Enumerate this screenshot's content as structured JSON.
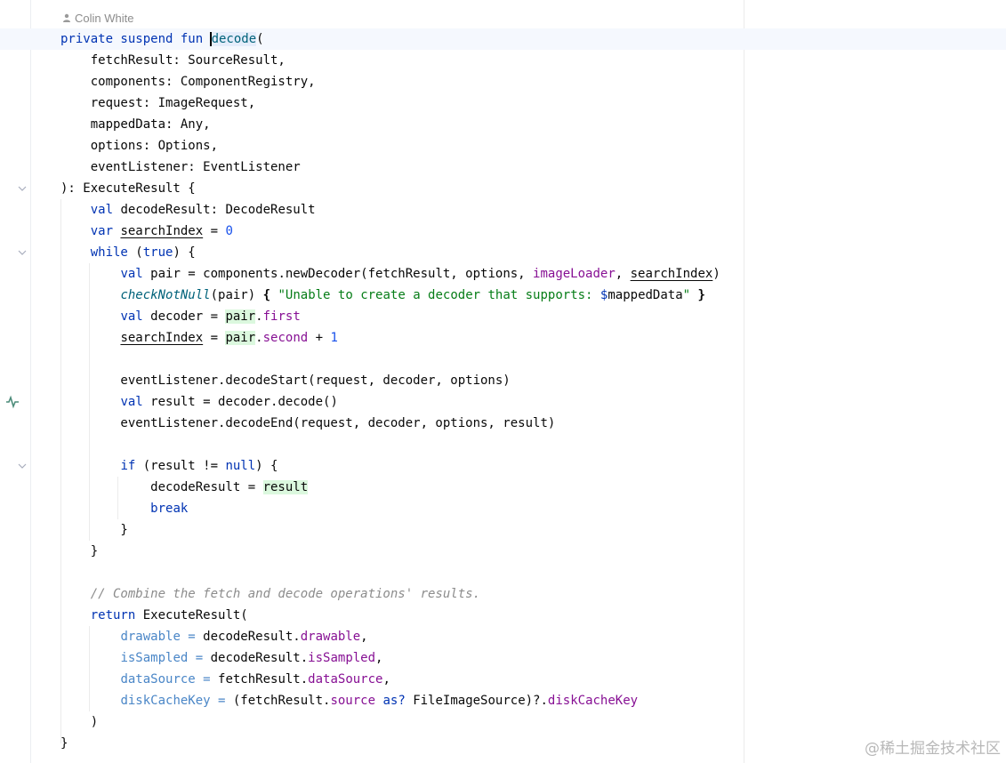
{
  "author": "Colin White",
  "watermark": "@稀土掘金技术社区",
  "code": {
    "l1": {
      "a": "private suspend fun ",
      "b": "decode",
      "c": "("
    },
    "l2": "    fetchResult: SourceResult,",
    "l3": "    components: ComponentRegistry,",
    "l4": "    request: ImageRequest,",
    "l5": "    mappedData: Any,",
    "l6": "    options: Options,",
    "l7": "    eventListener: EventListener",
    "l8": "): ExecuteResult {",
    "l9": {
      "a": "    ",
      "kw": "val",
      "b": " decodeResult: DecodeResult"
    },
    "l10": {
      "a": "    ",
      "kw": "var",
      "sp": " ",
      "ul": "searchIndex",
      "b": " = ",
      "num": "0"
    },
    "l11": {
      "a": "    ",
      "kw": "while",
      "b": " (",
      "kw2": "true",
      "c": ") {"
    },
    "l12": {
      "a": "        ",
      "kw": "val",
      "b": " pair = components.newDecoder(fetchResult, options, ",
      "prop": "imageLoader",
      "c": ", ",
      "ul": "searchIndex",
      "d": ")"
    },
    "l13": {
      "a": "        ",
      "fn": "checkNotNull",
      "b": "(pair) ",
      "br1": "{",
      "sp": " ",
      "str": "\"Unable to create a decoder that supports: ",
      "dollar": "$",
      "tmpl": "mappedData",
      "strend": "\"",
      "sp2": " ",
      "br2": "}"
    },
    "l14": {
      "a": "        ",
      "kw": "val",
      "b": " decoder = ",
      "hl": "pair",
      "c": ".",
      "prop": "first"
    },
    "l15": {
      "a": "        ",
      "ul": "searchIndex",
      "b": " = ",
      "hl": "pair",
      "c": ".",
      "prop": "second",
      "d": " + ",
      "num": "1"
    },
    "l16": "",
    "l17": "        eventListener.decodeStart(request, decoder, options)",
    "l18": {
      "a": "        ",
      "kw": "val",
      "b": " result = decoder.decode()"
    },
    "l19": "        eventListener.decodeEnd(request, decoder, options, result)",
    "l20": "",
    "l21": {
      "a": "        ",
      "kw": "if",
      "b": " (result != ",
      "kw2": "null",
      "c": ") {"
    },
    "l22": {
      "a": "            decodeResult = ",
      "hl": "result"
    },
    "l23": {
      "a": "            ",
      "kw": "break"
    },
    "l24": "        }",
    "l25": "    }",
    "l26": "",
    "l27": "    // Combine the fetch and decode operations' results.",
    "l28": {
      "a": "    ",
      "kw": "return",
      "b": " ExecuteResult("
    },
    "l29": {
      "a": "        ",
      "named": "drawable = ",
      "b": "decodeResult.",
      "prop": "drawable",
      "c": ","
    },
    "l30": {
      "a": "        ",
      "named": "isSampled = ",
      "b": "decodeResult.",
      "prop": "isSampled",
      "c": ","
    },
    "l31": {
      "a": "        ",
      "named": "dataSource = ",
      "b": "fetchResult.",
      "prop": "dataSource",
      "c": ","
    },
    "l32": {
      "a": "        ",
      "named": "diskCacheKey = ",
      "b": "(fetchResult.",
      "prop": "source",
      "sp": " ",
      "kw": "as?",
      "c": " FileImageSource)?.",
      "prop2": "diskCacheKey"
    },
    "l33": "    )",
    "l34": "}"
  },
  "colors": {
    "keyword": "#0033b3",
    "function": "#00627a",
    "string": "#067d17",
    "number": "#1750eb",
    "property": "#871094",
    "comment": "#8c8c8c",
    "named_arg": "#4a86c7",
    "smart_cast_highlight": "#dbf8de"
  },
  "icons": [
    "lightbulb-icon",
    "person-icon",
    "fold-chevron-icon",
    "suspend-call-icon"
  ]
}
